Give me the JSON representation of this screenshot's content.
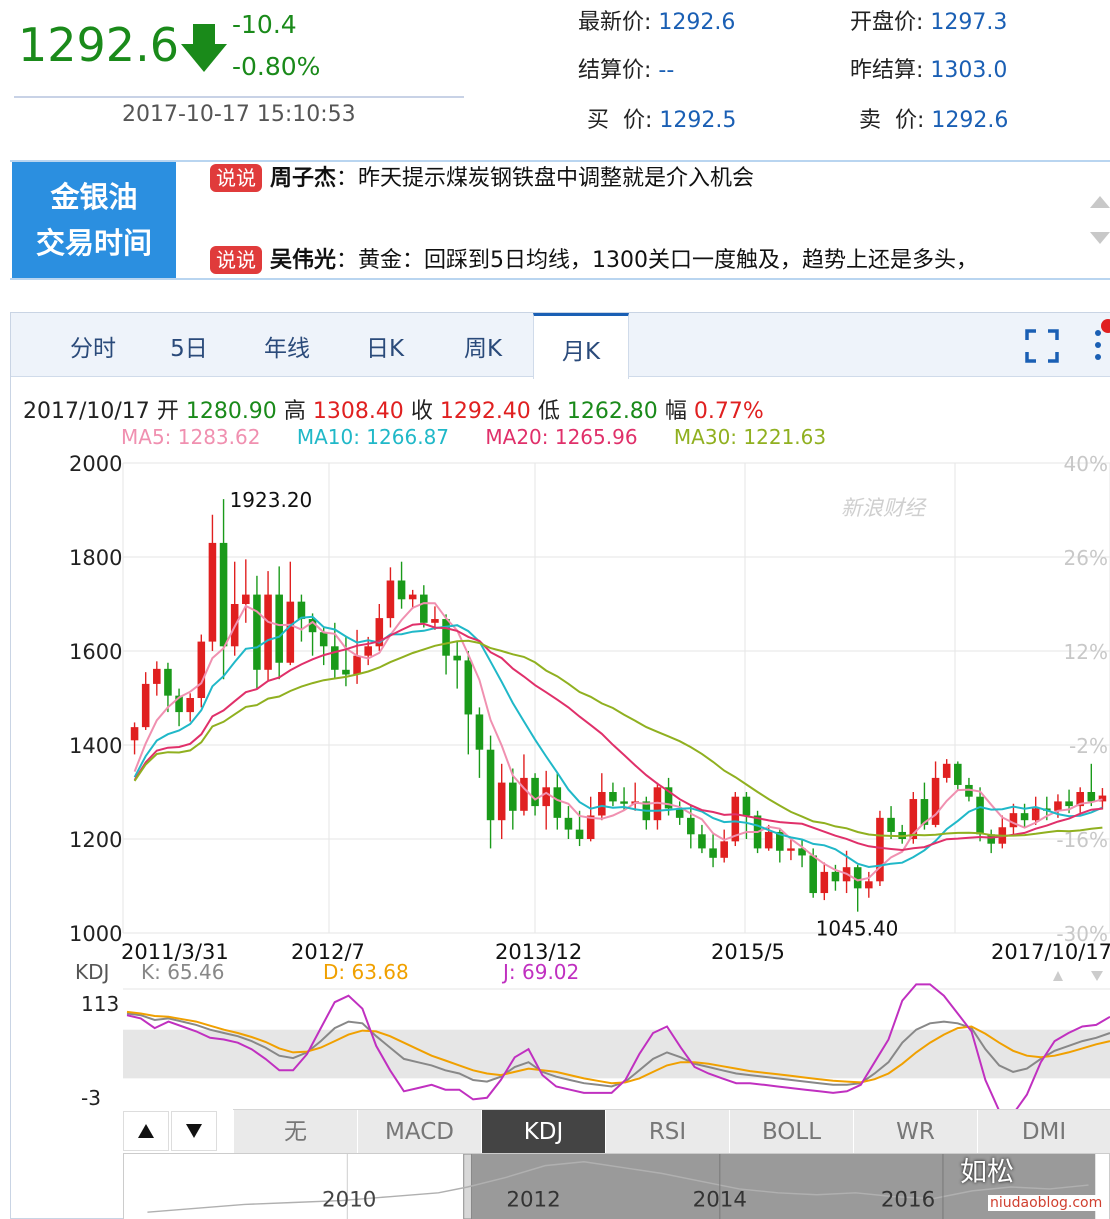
{
  "quote": {
    "price": "1292.6",
    "change": "-10.4",
    "change_pct": "-0.80%",
    "time": "2017-10-17 15:10:53",
    "latest_label": "最新价:",
    "latest": "1292.6",
    "open_label": "开盘价:",
    "open": "1297.3",
    "settle_label": "结算价:",
    "settle": "--",
    "prev_settle_label": "昨结算:",
    "prev_settle": "1303.0",
    "bid_label": "买  价:",
    "bid": "1292.5",
    "ask_label": "卖  价:",
    "ask": "1292.6",
    "down_color": "#1a8a1a"
  },
  "ticker": {
    "title_line1": "金银油",
    "title_line2": "交易时间",
    "items": [
      {
        "badge": "说说",
        "name": "周子杰",
        "text": "：昨天提示煤炭钢铁盘中调整就是介入机会"
      },
      {
        "badge": "说说",
        "name": "吴伟光",
        "text": "：黄金：回踩到5日均线，1300关口一度触及，趋势上还是多头，"
      }
    ]
  },
  "tabs": [
    "分时",
    "5日",
    "年线",
    "日K",
    "周K",
    "月K"
  ],
  "active_tab": "月K",
  "ohlc": {
    "date": "2017/10/17",
    "open_label": "开",
    "open": "1280.90",
    "high_label": "高",
    "high": "1308.40",
    "close_label": "收",
    "close": "1292.40",
    "low_label": "低",
    "low": "1262.80",
    "amp_label": "幅",
    "amp": "0.77%"
  },
  "ma_legend": [
    {
      "label": "MA5: 1283.62",
      "color": "#f090b0"
    },
    {
      "label": "MA10: 1266.87",
      "color": "#20b8c8"
    },
    {
      "label": "MA20: 1265.96",
      "color": "#e0306a"
    },
    {
      "label": "MA30: 1221.63",
      "color": "#90b020"
    }
  ],
  "kdj_legend": {
    "name": "KDJ",
    "k": "K: 65.46",
    "d": "D: 63.68",
    "j": "J: 69.02",
    "k_color": "#888888",
    "d_color": "#f0a000",
    "j_color": "#c030c0"
  },
  "watermark": "新浪财经",
  "indicators": [
    "无",
    "MACD",
    "KDJ",
    "RSI",
    "BOLL",
    "WR",
    "DMI"
  ],
  "active_indicator": "KDJ",
  "overview": {
    "years": [
      "2010",
      "2012",
      "2014",
      "2016"
    ]
  },
  "wm_text": "如松",
  "wm_url": "niudaoblog.com",
  "chart_data": {
    "type": "candlestick",
    "y_ticks": [
      "2000",
      "1800",
      "1600",
      "1400",
      "1200",
      "1000"
    ],
    "y_range": [
      1000,
      2000
    ],
    "pct_ticks": [
      "40%",
      "26%",
      "12%",
      "-2%",
      "-16%",
      "-30%"
    ],
    "x_labels": [
      "2011/3/31",
      "2012/7",
      "2013/12",
      "2015/5",
      "2017/10/17"
    ],
    "annotations": [
      {
        "text": "1923.20"
      },
      {
        "text": "1045.40"
      }
    ],
    "up_color": "#e02020",
    "down_color": "#1a9a1a",
    "candles": [
      [
        1410,
        1438,
        1448,
        1380
      ],
      [
        1438,
        1530,
        1555,
        1432
      ],
      [
        1530,
        1562,
        1578,
        1505
      ],
      [
        1562,
        1505,
        1575,
        1470
      ],
      [
        1505,
        1470,
        1520,
        1440
      ],
      [
        1470,
        1500,
        1510,
        1450
      ],
      [
        1500,
        1620,
        1635,
        1480
      ],
      [
        1620,
        1830,
        1890,
        1600
      ],
      [
        1830,
        1610,
        1923.2,
        1540
      ],
      [
        1610,
        1700,
        1790,
        1590
      ],
      [
        1700,
        1720,
        1795,
        1660
      ],
      [
        1720,
        1560,
        1760,
        1520
      ],
      [
        1560,
        1720,
        1770,
        1535
      ],
      [
        1720,
        1575,
        1780,
        1540
      ],
      [
        1575,
        1705,
        1790,
        1570
      ],
      [
        1705,
        1668,
        1720,
        1620
      ],
      [
        1668,
        1640,
        1680,
        1590
      ],
      [
        1640,
        1610,
        1650,
        1570
      ],
      [
        1610,
        1560,
        1660,
        1540
      ],
      [
        1560,
        1550,
        1630,
        1525
      ],
      [
        1550,
        1590,
        1645,
        1530
      ],
      [
        1590,
        1610,
        1630,
        1570
      ],
      [
        1610,
        1670,
        1700,
        1600
      ],
      [
        1670,
        1750,
        1778,
        1650
      ],
      [
        1750,
        1710,
        1790,
        1690
      ],
      [
        1710,
        1720,
        1730,
        1690
      ],
      [
        1720,
        1660,
        1740,
        1650
      ],
      [
        1660,
        1668,
        1695,
        1645
      ],
      [
        1668,
        1590,
        1678,
        1550
      ],
      [
        1590,
        1580,
        1620,
        1520
      ],
      [
        1580,
        1465,
        1600,
        1380
      ],
      [
        1465,
        1390,
        1480,
        1330
      ],
      [
        1390,
        1240,
        1420,
        1180
      ],
      [
        1240,
        1320,
        1360,
        1200
      ],
      [
        1320,
        1260,
        1350,
        1220
      ],
      [
        1260,
        1330,
        1380,
        1250
      ],
      [
        1330,
        1270,
        1340,
        1250
      ],
      [
        1270,
        1310,
        1345,
        1220
      ],
      [
        1310,
        1245,
        1340,
        1220
      ],
      [
        1245,
        1220,
        1270,
        1200
      ],
      [
        1220,
        1200,
        1260,
        1185
      ],
      [
        1200,
        1250,
        1290,
        1195
      ],
      [
        1250,
        1300,
        1340,
        1240
      ],
      [
        1300,
        1280,
        1320,
        1270
      ],
      [
        1280,
        1275,
        1310,
        1260
      ],
      [
        1275,
        1280,
        1320,
        1260
      ],
      [
        1280,
        1240,
        1290,
        1220
      ],
      [
        1240,
        1310,
        1320,
        1220
      ],
      [
        1310,
        1265,
        1330,
        1250
      ],
      [
        1265,
        1245,
        1280,
        1230
      ],
      [
        1245,
        1210,
        1270,
        1180
      ],
      [
        1210,
        1180,
        1230,
        1170
      ],
      [
        1180,
        1160,
        1210,
        1140
      ],
      [
        1160,
        1195,
        1220,
        1150
      ],
      [
        1195,
        1290,
        1300,
        1185
      ],
      [
        1290,
        1250,
        1300,
        1200
      ],
      [
        1250,
        1180,
        1260,
        1170
      ],
      [
        1180,
        1215,
        1230,
        1175
      ],
      [
        1215,
        1175,
        1220,
        1150
      ],
      [
        1175,
        1180,
        1205,
        1155
      ],
      [
        1180,
        1165,
        1200,
        1140
      ],
      [
        1165,
        1085,
        1180,
        1075
      ],
      [
        1085,
        1130,
        1150,
        1070
      ],
      [
        1130,
        1110,
        1145,
        1090
      ],
      [
        1110,
        1140,
        1175,
        1085
      ],
      [
        1140,
        1095,
        1145,
        1045.4
      ],
      [
        1095,
        1110,
        1130,
        1075
      ],
      [
        1110,
        1245,
        1260,
        1100
      ],
      [
        1245,
        1215,
        1270,
        1200
      ],
      [
        1215,
        1200,
        1230,
        1190
      ],
      [
        1200,
        1285,
        1300,
        1190
      ],
      [
        1285,
        1230,
        1320,
        1220
      ],
      [
        1230,
        1330,
        1365,
        1225
      ],
      [
        1330,
        1360,
        1370,
        1320
      ],
      [
        1360,
        1315,
        1365,
        1305
      ],
      [
        1315,
        1290,
        1330,
        1280
      ],
      [
        1290,
        1210,
        1310,
        1195
      ],
      [
        1210,
        1190,
        1220,
        1170
      ],
      [
        1190,
        1225,
        1250,
        1180
      ],
      [
        1225,
        1255,
        1275,
        1210
      ],
      [
        1255,
        1240,
        1275,
        1225
      ],
      [
        1240,
        1265,
        1290,
        1230
      ],
      [
        1265,
        1260,
        1290,
        1240
      ],
      [
        1260,
        1280,
        1295,
        1245
      ],
      [
        1280,
        1270,
        1305,
        1255
      ],
      [
        1270,
        1300,
        1310,
        1250
      ],
      [
        1300,
        1280,
        1360,
        1270
      ],
      [
        1280,
        1292.4,
        1308.4,
        1262.8
      ]
    ],
    "kdj": {
      "y_ticks": [
        "113",
        "-3"
      ],
      "y_range": [
        -3,
        113
      ],
      "k": [
        100,
        98,
        92,
        94,
        90,
        86,
        80,
        76,
        72,
        66,
        58,
        48,
        45,
        52,
        66,
        82,
        90,
        88,
        72,
        58,
        44,
        40,
        36,
        30,
        26,
        18,
        16,
        22,
        34,
        40,
        28,
        22,
        18,
        14,
        12,
        10,
        16,
        30,
        44,
        52,
        46,
        38,
        34,
        30,
        26,
        24,
        22,
        20,
        18,
        16,
        14,
        12,
        12,
        14,
        26,
        40,
        64,
        80,
        88,
        90,
        88,
        82,
        56,
        36,
        28,
        32,
        44,
        54,
        60,
        66,
        70,
        76
      ],
      "d": [
        102,
        100,
        97,
        96,
        93,
        90,
        85,
        80,
        76,
        71,
        65,
        57,
        52,
        53,
        58,
        66,
        74,
        79,
        78,
        72,
        64,
        56,
        48,
        42,
        36,
        30,
        26,
        24,
        28,
        32,
        30,
        28,
        24,
        20,
        17,
        14,
        15,
        20,
        28,
        36,
        40,
        40,
        38,
        35,
        32,
        29,
        27,
        25,
        23,
        21,
        19,
        17,
        16,
        15,
        19,
        26,
        38,
        52,
        64,
        74,
        82,
        84,
        75,
        64,
        54,
        48,
        46,
        48,
        52,
        57,
        62,
        66
      ],
      "j": [
        98,
        94,
        82,
        90,
        84,
        78,
        70,
        68,
        64,
        56,
        44,
        30,
        30,
        50,
        82,
        114,
        122,
        106,
        60,
        30,
        4,
        8,
        12,
        6,
        6,
        -6,
        -4,
        18,
        46,
        56,
        24,
        10,
        6,
        2,
        2,
        2,
        18,
        50,
        76,
        84,
        58,
        34,
        26,
        20,
        14,
        14,
        12,
        10,
        8,
        6,
        4,
        2,
        4,
        12,
        40,
        68,
        116,
        136,
        136,
        122,
        100,
        78,
        18,
        -20,
        -24,
        0,
        40,
        66,
        76,
        84,
        86,
        96
      ]
    }
  }
}
